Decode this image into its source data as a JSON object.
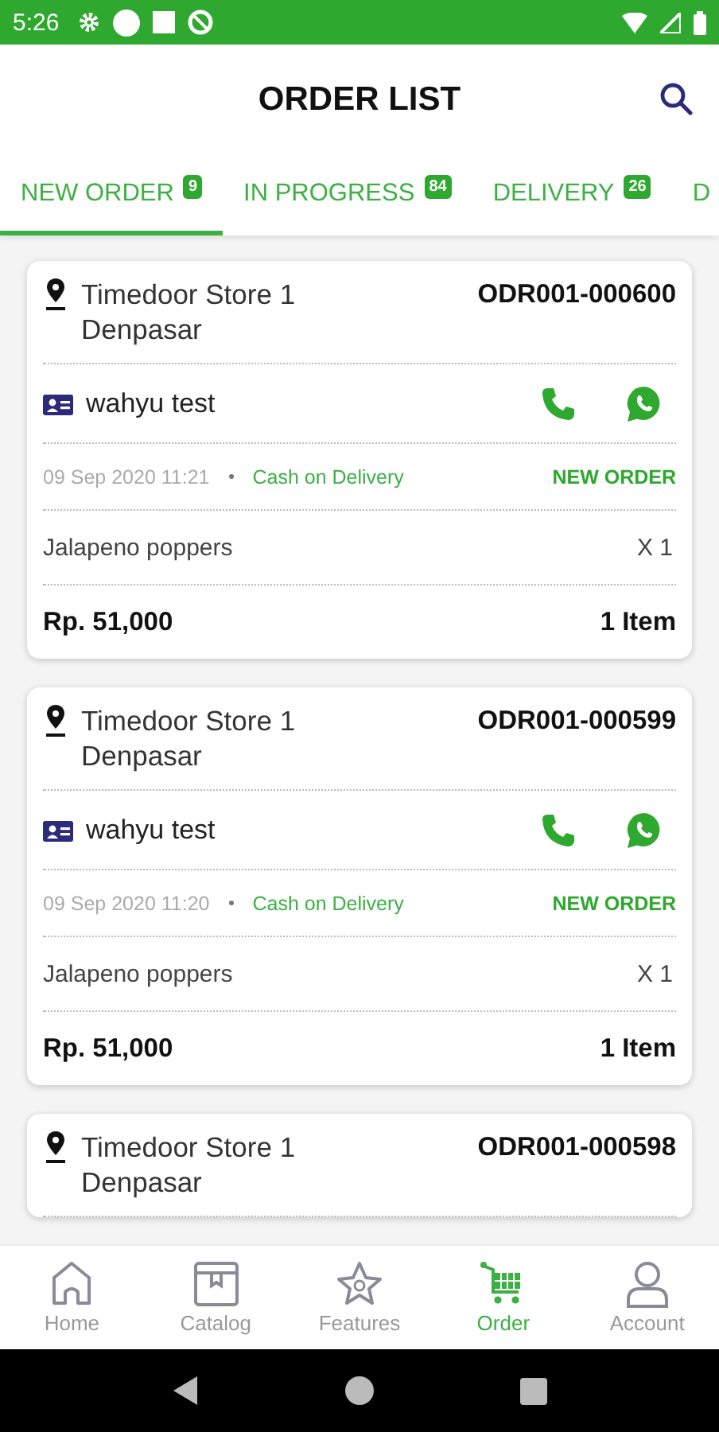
{
  "status_bar": {
    "time": "5:26"
  },
  "header": {
    "title": "ORDER LIST"
  },
  "tabs": [
    {
      "label": "NEW ORDER",
      "count": "9",
      "selected": true
    },
    {
      "label": "IN PROGRESS",
      "count": "84",
      "selected": false
    },
    {
      "label": "DELIVERY",
      "count": "26",
      "selected": false
    },
    {
      "label": "D",
      "selected": false
    }
  ],
  "orders": [
    {
      "store": "Timedoor Store 1",
      "city": "Denpasar",
      "order_no": "ODR001-000600",
      "customer": "wahyu test",
      "date": "09 Sep 2020 11:21",
      "payment": "Cash on Delivery",
      "status": "NEW ORDER",
      "items": [
        {
          "name": "Jalapeno poppers",
          "qty": "X 1"
        }
      ],
      "total": "Rp. 51,000",
      "item_count": "1 Item"
    },
    {
      "store": "Timedoor Store 1",
      "city": "Denpasar",
      "order_no": "ODR001-000599",
      "customer": "wahyu test",
      "date": "09 Sep 2020 11:20",
      "payment": "Cash on Delivery",
      "status": "NEW ORDER",
      "items": [
        {
          "name": "Jalapeno poppers",
          "qty": "X 1"
        }
      ],
      "total": "Rp. 51,000",
      "item_count": "1 Item"
    },
    {
      "store": "Timedoor Store 1",
      "city": "Denpasar",
      "order_no": "ODR001-000598"
    }
  ],
  "bottom_nav": [
    {
      "label": "Home",
      "kind": "home",
      "selected": false
    },
    {
      "label": "Catalog",
      "kind": "catalog",
      "selected": false
    },
    {
      "label": "Features",
      "kind": "features",
      "selected": false
    },
    {
      "label": "Order",
      "kind": "order",
      "selected": true
    },
    {
      "label": "Account",
      "kind": "account",
      "selected": false
    }
  ]
}
